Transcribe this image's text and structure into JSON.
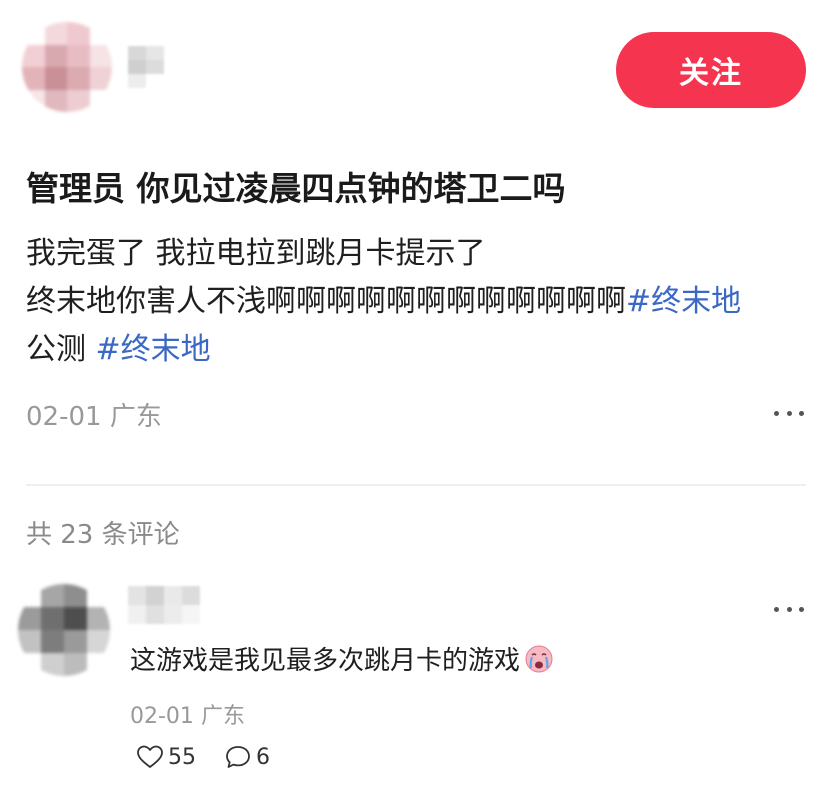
{
  "post": {
    "follow_label": "关注",
    "title": "管理员 你见过凌晨四点钟的塔卫二吗",
    "body_line1": "我完蛋了 我拉电拉到跳月卡提示了",
    "body_line2_text": "终末地你害人不浅啊啊啊啊啊啊啊啊啊啊啊啊",
    "hashtag1": "#终末地",
    "body_line3_text": "公测 ",
    "hashtag2": "#终末地",
    "date": "02-01",
    "location": "广东"
  },
  "comments": {
    "count_label": "共 23 条评论",
    "items": [
      {
        "text": "这游戏是我见最多次跳月卡的游戏",
        "emoji": "crying-face-emoji",
        "date": "02-01",
        "location": "广东",
        "likes": "55",
        "replies": "6"
      }
    ]
  },
  "colors": {
    "follow_button": "#f5354f",
    "hashtag": "#3b68c5",
    "meta_text": "#999999"
  },
  "icons": {
    "post_more": "more-dots-icon",
    "comment_more": "more-dots-icon",
    "like": "heart-outline-icon",
    "reply": "speech-bubble-icon"
  }
}
